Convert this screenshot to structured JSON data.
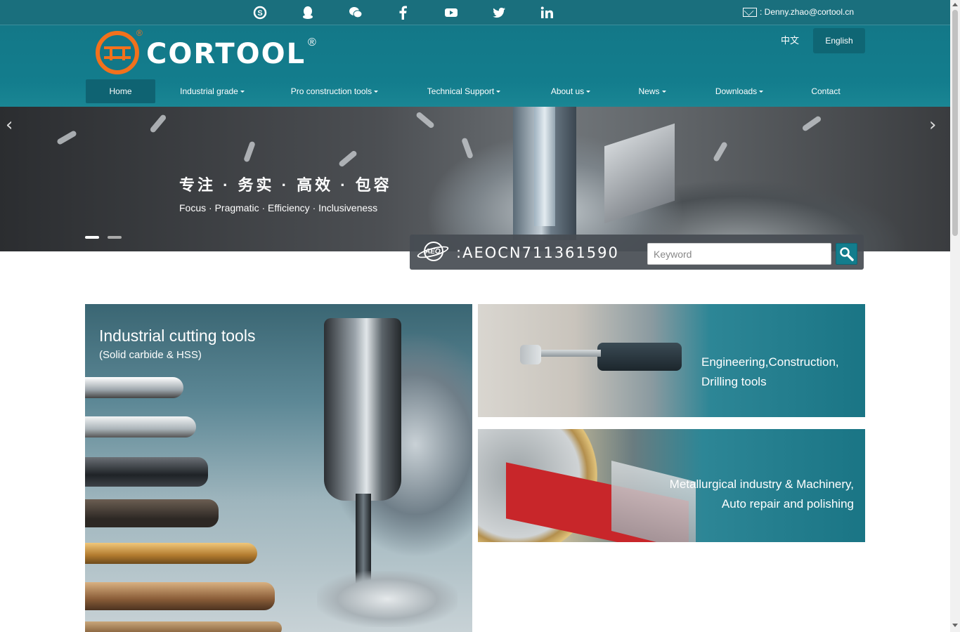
{
  "top_bar": {
    "social_icons": [
      "skype-icon",
      "qq-icon",
      "wechat-icon",
      "facebook-icon",
      "youtube-icon",
      "twitter-icon",
      "linkedin-icon"
    ],
    "email_label": ": Denny.zhao@cortool.cn"
  },
  "header": {
    "logo_text": "CORTOOL",
    "logo_reg": "®",
    "lang_zh": "中文",
    "lang_en": "English"
  },
  "nav": {
    "items": [
      {
        "label": "Home",
        "dropdown": false,
        "active": true
      },
      {
        "label": "Industrial grade",
        "dropdown": true
      },
      {
        "label": "Pro construction tools",
        "dropdown": true
      },
      {
        "label": "Technical Support",
        "dropdown": true
      },
      {
        "label": "About us",
        "dropdown": true
      },
      {
        "label": "News",
        "dropdown": true
      },
      {
        "label": "Downloads",
        "dropdown": true
      },
      {
        "label": "Contact",
        "dropdown": false
      }
    ]
  },
  "banner": {
    "headline_cn": "专注 · 务实 · 高效 · 包容",
    "headline_en": "Focus · Pragmatic · Efficiency · Inclusiveness",
    "slide_count": 2,
    "active_slide": 1
  },
  "aeo": {
    "logo_text": "AEO",
    "code": ":AEOCN711361590",
    "search_placeholder": "Keyword"
  },
  "tiles": {
    "industrial": {
      "title": "Industrial cutting tools",
      "subtitle": "(Solid carbide & HSS)"
    },
    "engineering": {
      "line1": "Engineering,Construction,",
      "line2": "Drilling tools"
    },
    "metallurgical": {
      "line1": "Metallurgical industry & Machinery,",
      "line2": "Auto repair and polishing"
    }
  },
  "colors": {
    "header_teal": "#137d8d",
    "topbar_teal": "#1a6f7d",
    "logo_orange": "#f2711c",
    "nav_active": "#0f6372"
  }
}
